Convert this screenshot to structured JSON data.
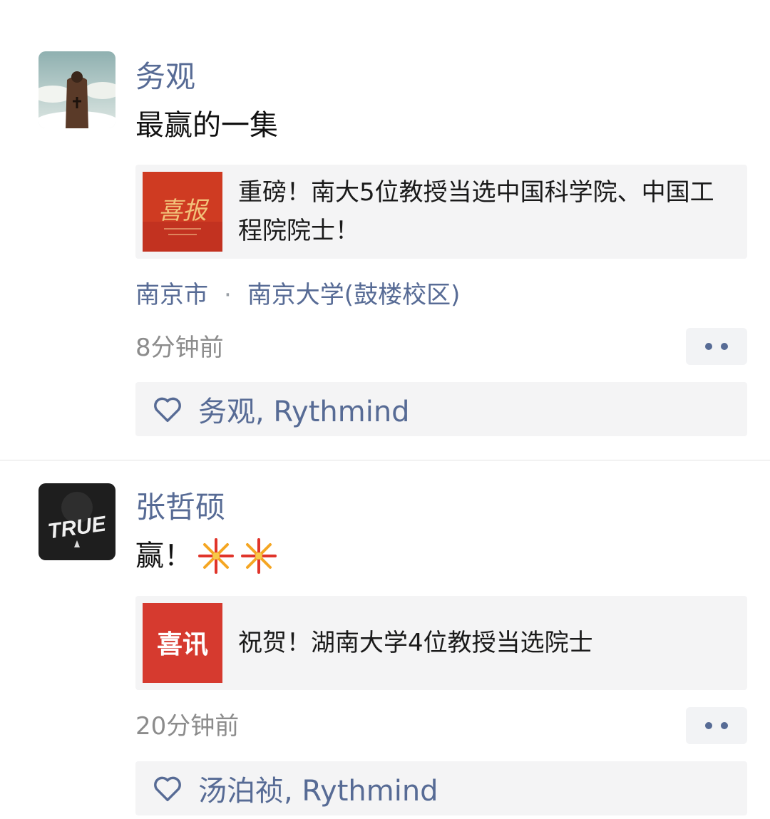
{
  "posts": [
    {
      "author": "务观",
      "text": "最赢的一集",
      "link_title": "重磅！南大5位教授当选中国科学院、中国工程院院士！",
      "link_thumb_text": "喜报",
      "location": {
        "city": "南京市",
        "separator": "·",
        "place": "南京大学(鼓楼校区)"
      },
      "time": "8分钟前",
      "likes": "务观, Rythmind"
    },
    {
      "author": "张哲硕",
      "text": "赢！",
      "link_title": "祝贺！湖南大学4位教授当选院士",
      "link_thumb_text": "喜讯",
      "avatar_text": "TRUE",
      "time": "20分钟前",
      "likes": "汤泊祯, Rythmind"
    }
  ],
  "icons": {
    "more": "more-dots-icon",
    "like": "heart-outline-icon",
    "emoji": "fireworks-emoji"
  },
  "colors": {
    "link_blue": "#576b95",
    "card_bg": "#f4f4f5",
    "thumb_red": "#d63a2f"
  }
}
